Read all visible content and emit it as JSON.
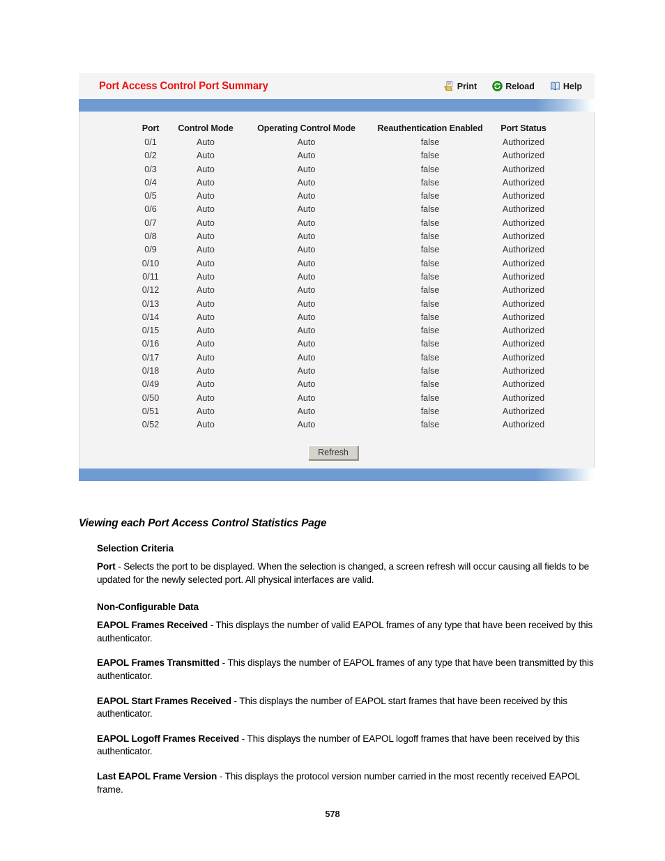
{
  "panel": {
    "title": "Port Access Control Port Summary",
    "actions": [
      {
        "label": "Print",
        "icon": "printer-icon"
      },
      {
        "label": "Reload",
        "icon": "reload-icon"
      },
      {
        "label": "Help",
        "icon": "help-book-icon"
      }
    ],
    "table": {
      "headers": [
        "Port",
        "Control Mode",
        "Operating Control Mode",
        "Reauthentication Enabled",
        "Port Status"
      ],
      "rows": [
        [
          "0/1",
          "Auto",
          "Auto",
          "false",
          "Authorized"
        ],
        [
          "0/2",
          "Auto",
          "Auto",
          "false",
          "Authorized"
        ],
        [
          "0/3",
          "Auto",
          "Auto",
          "false",
          "Authorized"
        ],
        [
          "0/4",
          "Auto",
          "Auto",
          "false",
          "Authorized"
        ],
        [
          "0/5",
          "Auto",
          "Auto",
          "false",
          "Authorized"
        ],
        [
          "0/6",
          "Auto",
          "Auto",
          "false",
          "Authorized"
        ],
        [
          "0/7",
          "Auto",
          "Auto",
          "false",
          "Authorized"
        ],
        [
          "0/8",
          "Auto",
          "Auto",
          "false",
          "Authorized"
        ],
        [
          "0/9",
          "Auto",
          "Auto",
          "false",
          "Authorized"
        ],
        [
          "0/10",
          "Auto",
          "Auto",
          "false",
          "Authorized"
        ],
        [
          "0/11",
          "Auto",
          "Auto",
          "false",
          "Authorized"
        ],
        [
          "0/12",
          "Auto",
          "Auto",
          "false",
          "Authorized"
        ],
        [
          "0/13",
          "Auto",
          "Auto",
          "false",
          "Authorized"
        ],
        [
          "0/14",
          "Auto",
          "Auto",
          "false",
          "Authorized"
        ],
        [
          "0/15",
          "Auto",
          "Auto",
          "false",
          "Authorized"
        ],
        [
          "0/16",
          "Auto",
          "Auto",
          "false",
          "Authorized"
        ],
        [
          "0/17",
          "Auto",
          "Auto",
          "false",
          "Authorized"
        ],
        [
          "0/18",
          "Auto",
          "Auto",
          "false",
          "Authorized"
        ],
        [
          "0/49",
          "Auto",
          "Auto",
          "false",
          "Authorized"
        ],
        [
          "0/50",
          "Auto",
          "Auto",
          "false",
          "Authorized"
        ],
        [
          "0/51",
          "Auto",
          "Auto",
          "false",
          "Authorized"
        ],
        [
          "0/52",
          "Auto",
          "Auto",
          "false",
          "Authorized"
        ]
      ]
    },
    "refresh_label": "Refresh",
    "colors": {
      "title_red": "#ee1111",
      "bar_blue": "#6f9ad2",
      "body_gray": "#f3f3f3",
      "button_face": "#d6d3cb"
    }
  },
  "doc": {
    "section_heading": "Viewing each Port Access Control Statistics Page",
    "selection_criteria_heading": "Selection Criteria",
    "port_term": "Port",
    "port_desc": " - Selects the port to be displayed. When the selection is changed, a screen refresh will occur causing all fields to be updated for the newly selected port. All physical interfaces are valid.",
    "non_configurable_heading": "Non-Configurable Data",
    "items": [
      {
        "term": "EAPOL Frames Received",
        "desc": " - This displays the number of valid EAPOL frames of any type that have been received by this authenticator."
      },
      {
        "term": "EAPOL Frames Transmitted",
        "desc": " - This displays the number of EAPOL frames of any type that have been transmitted by this authenticator."
      },
      {
        "term": "EAPOL Start Frames Received",
        "desc": " - This displays the number of EAPOL start frames that have been received by this authenticator."
      },
      {
        "term": "EAPOL Logoff Frames Received",
        "desc": " - This displays the number of EAPOL logoff frames that have been received by this authenticator."
      },
      {
        "term": "Last EAPOL Frame Version",
        "desc": " - This displays the protocol version number carried in the most recently received EAPOL frame."
      }
    ]
  },
  "page_number": "578"
}
